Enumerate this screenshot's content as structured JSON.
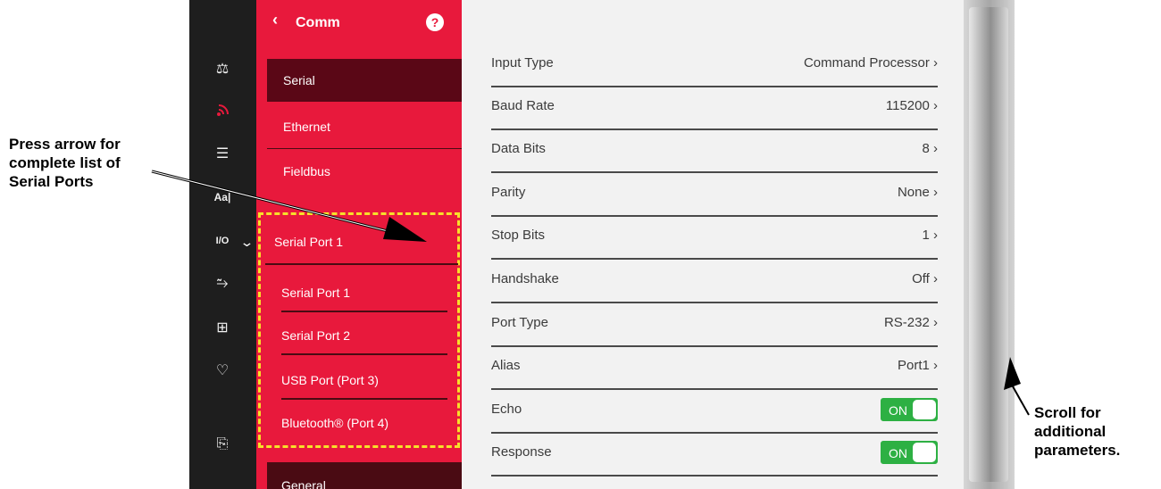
{
  "menu": {
    "back": "‹",
    "title": "Comm",
    "help": "?",
    "items": [
      {
        "label": "Serial",
        "selected": true
      },
      {
        "label": "Ethernet"
      },
      {
        "label": "Fieldbus"
      }
    ],
    "port_select": {
      "selected": "Serial Port 1",
      "chevron": "⌄"
    },
    "port_options": [
      "Serial Port 1",
      "Serial Port 2",
      "USB Port (Port 3)",
      "Bluetooth® (Port 4)"
    ],
    "general": "General"
  },
  "sidebar_icons": [
    "scale-icon",
    "comm-icon",
    "list-icon",
    "text-icon",
    "io-icon",
    "signal-icon",
    "network-icon",
    "health-icon",
    "export-icon"
  ],
  "parameters": [
    {
      "label": "Input Type",
      "value": "Command Processor ›"
    },
    {
      "label": "Baud Rate",
      "value": "115200 ›"
    },
    {
      "label": "Data Bits",
      "value": "8 ›"
    },
    {
      "label": "Parity",
      "value": "None ›"
    },
    {
      "label": "Stop Bits",
      "value": "1 ›"
    },
    {
      "label": "Handshake",
      "value": "Off ›"
    },
    {
      "label": "Port Type",
      "value": "RS-232 ›"
    },
    {
      "label": "Alias",
      "value": "Port1 ›"
    },
    {
      "label": "Echo",
      "toggle": "ON"
    },
    {
      "label": "Response",
      "toggle": "ON"
    }
  ],
  "callouts": {
    "left": [
      "Press arrow for",
      "complete list of",
      "Serial Ports"
    ],
    "right": [
      "Scroll for",
      "additional",
      "parameters."
    ]
  },
  "colors": {
    "accent": "#e8193c",
    "highlight": "#f7e02a",
    "toggle_on": "#2db043"
  }
}
